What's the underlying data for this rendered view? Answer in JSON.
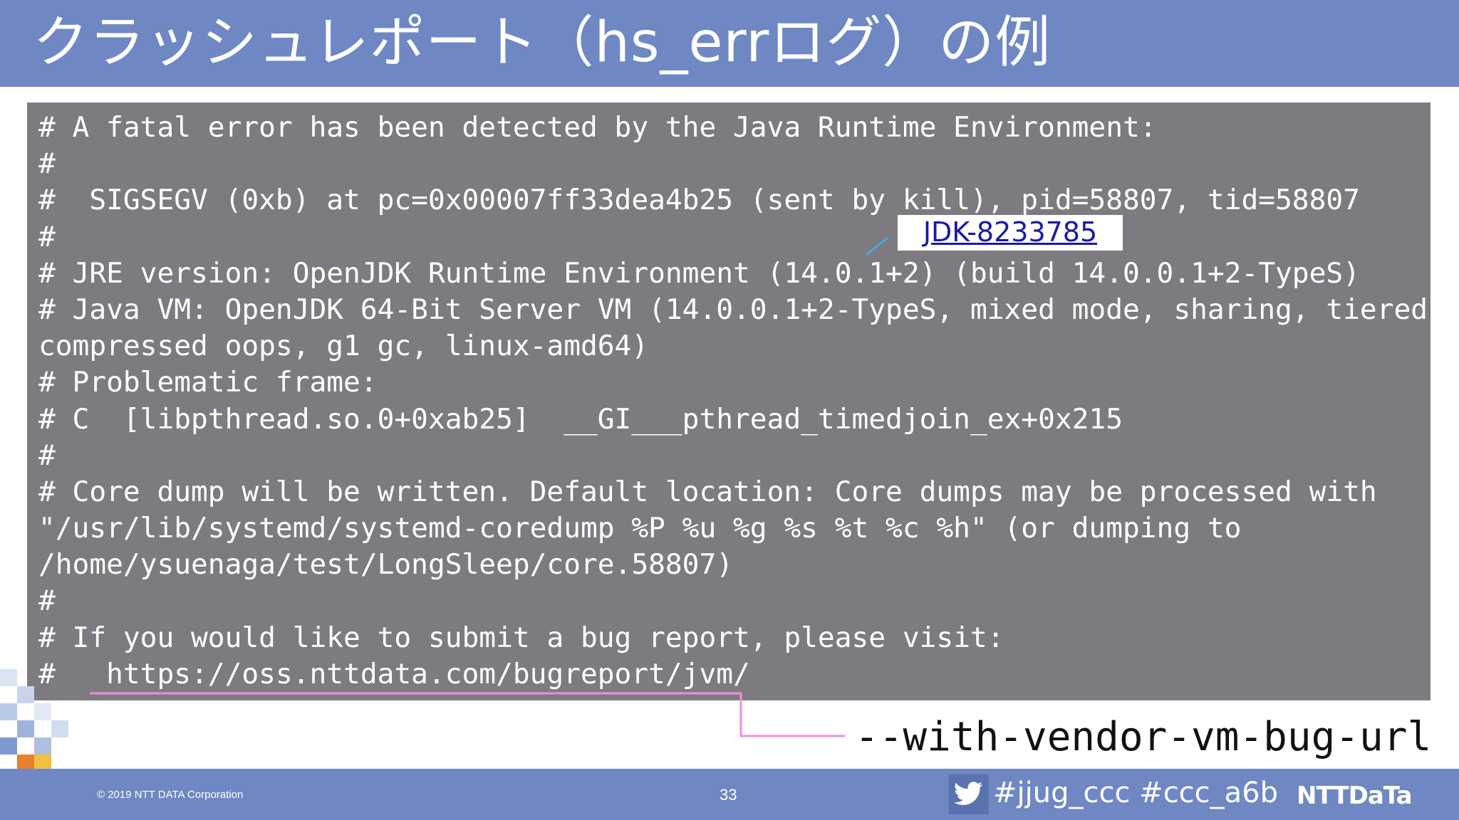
{
  "slide": {
    "title": "クラッシュレポート（hs_errログ）の例",
    "console_lines": [
      "# A fatal error has been detected by the Java Runtime Environment:",
      "#",
      "#  SIGSEGV (0xb) at pc=0x00007ff33dea4b25 (sent by kill), pid=58807, tid=58807",
      "#",
      "# JRE version: OpenJDK Runtime Environment (14.0.1+2) (build 14.0.0.1+2-TypeS)",
      "# Java VM: OpenJDK 64-Bit Server VM (14.0.0.1+2-TypeS, mixed mode, sharing, tiered,",
      "compressed oops, g1 gc, linux-amd64)",
      "# Problematic frame:",
      "# C  [libpthread.so.0+0xab25]  __GI___pthread_timedjoin_ex+0x215",
      "#",
      "# Core dump will be written. Default location: Core dumps may be processed with",
      "\"/usr/lib/systemd/systemd-coredump %P %u %g %s %t %c %h\" (or dumping to",
      "/home/ysuenaga/test/LongSleep/core.58807)",
      "#",
      "# If you would like to submit a bug report, please visit:",
      "#   https://oss.nttdata.com/bugreport/jvm/"
    ],
    "jdk_link": "JDK-8233785",
    "vendor_option": "--with-vendor-vm-bug-url"
  },
  "footer": {
    "copyright": "© 2019 NTT DATA Corporation",
    "page_number": "33",
    "hashtags": "#jjug_ccc #ccc_a6b",
    "logo": "NTTDaTa"
  },
  "colors": {
    "header_bg": "#6f88c4",
    "console_bg": "#7d7b7f",
    "callout_pink": "#f08ce0",
    "callout_blue": "#4aa8e8",
    "link_blue": "#1a1aa6"
  },
  "icons": {
    "twitter": "twitter-bird-icon"
  }
}
